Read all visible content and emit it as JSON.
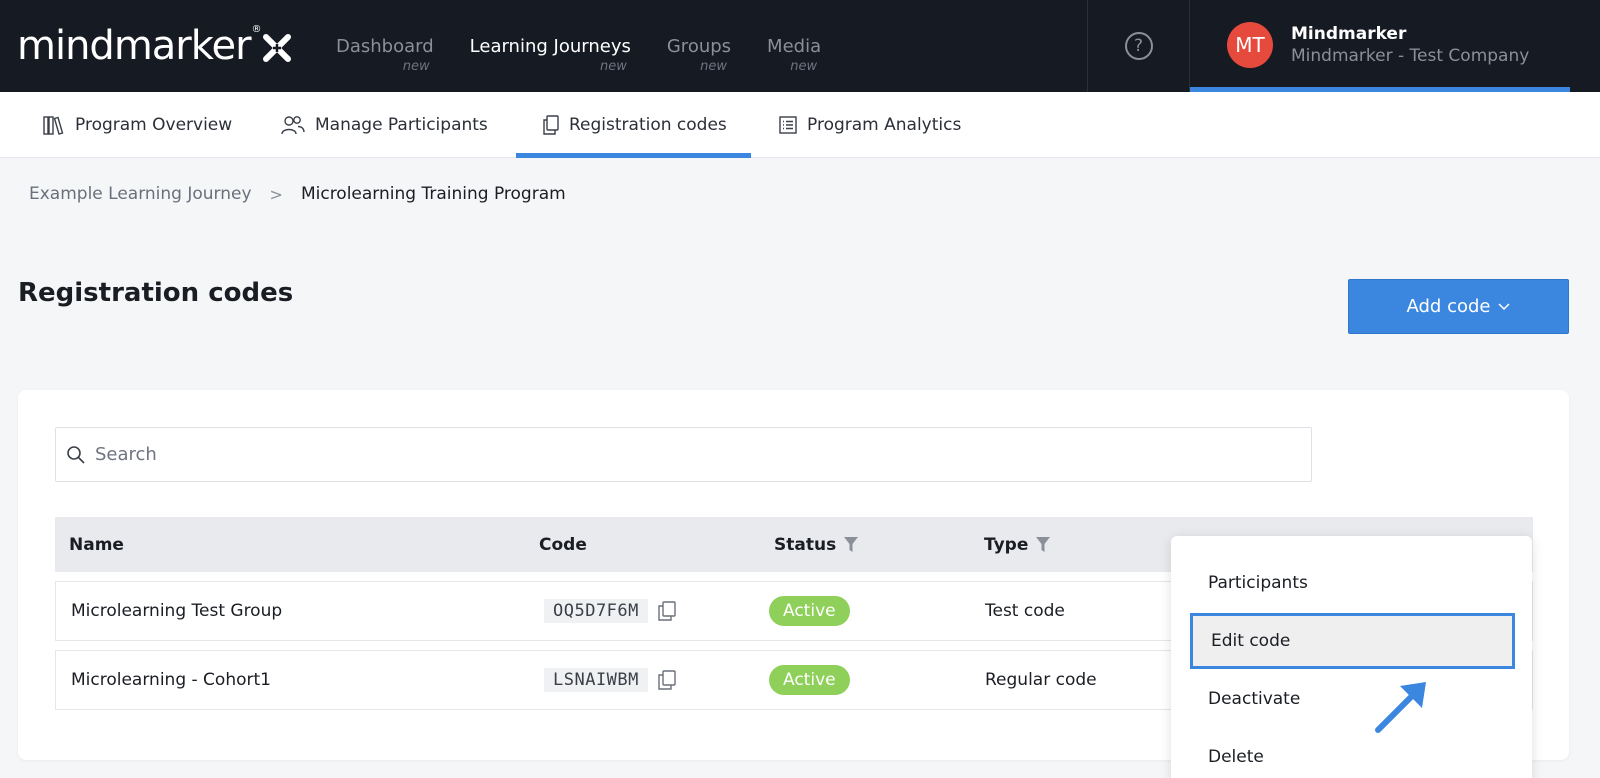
{
  "brand": {
    "name": "mindmarker",
    "reg": "®"
  },
  "nav": [
    {
      "label": "Dashboard",
      "sub": "new"
    },
    {
      "label": "Learning Journeys",
      "sub": "new"
    },
    {
      "label": "Groups",
      "sub": "new"
    },
    {
      "label": "Media",
      "sub": "new"
    }
  ],
  "help": {
    "icon": "?"
  },
  "account": {
    "initials": "MT",
    "name": "Mindmarker",
    "company": "Mindmarker - Test Company"
  },
  "subtabs": [
    {
      "label": "Program Overview",
      "icon": "books-icon"
    },
    {
      "label": "Manage Participants",
      "icon": "users-icon"
    },
    {
      "label": "Registration codes",
      "icon": "copy-icon"
    },
    {
      "label": "Program Analytics",
      "icon": "list-icon"
    }
  ],
  "breadcrumb": {
    "parent": "Example Learning Journey",
    "separator": ">",
    "current": "Microlearning Training Program"
  },
  "page": {
    "title": "Registration codes",
    "add_button": "Add code"
  },
  "search": {
    "placeholder": "Search",
    "value": ""
  },
  "table": {
    "columns": [
      "Name",
      "Code",
      "Status",
      "Type"
    ],
    "rows": [
      {
        "name": "Microlearning Test Group",
        "code": "OQ5D7F6M",
        "status": "Active",
        "type": "Test code"
      },
      {
        "name": "Microlearning - Cohort1",
        "code": "LSNAIWBM",
        "status": "Active",
        "type": "Regular code"
      }
    ]
  },
  "menu": {
    "items": [
      "Participants",
      "Edit code",
      "Deactivate",
      "Delete"
    ]
  },
  "colors": {
    "accent": "#3b87e0",
    "topbar": "#161a23",
    "active_badge": "#8ed05a",
    "avatar": "#e54a3c"
  }
}
